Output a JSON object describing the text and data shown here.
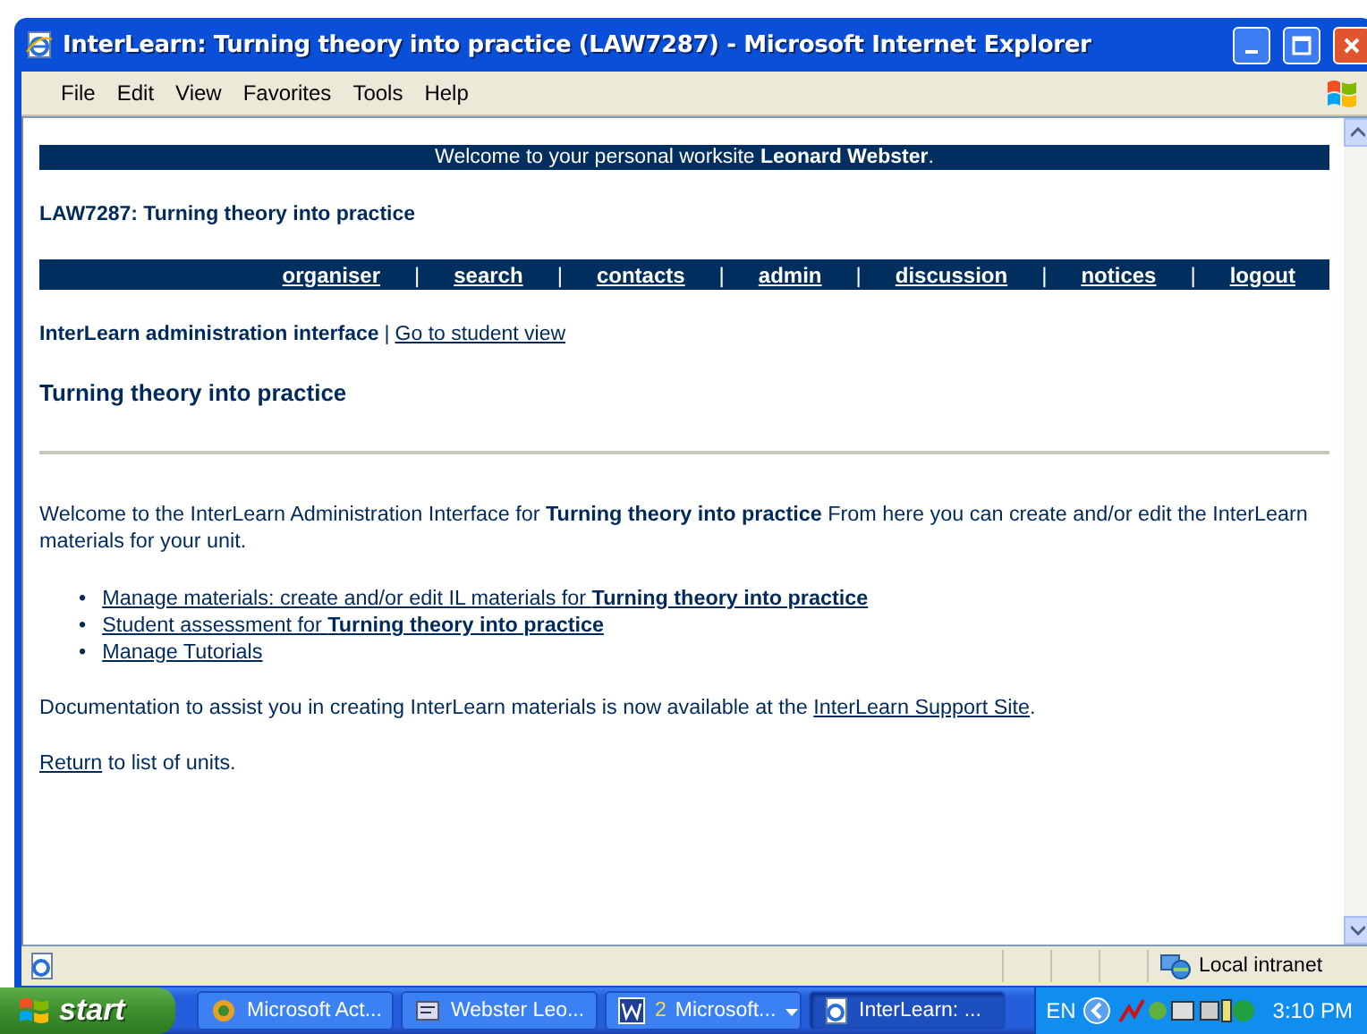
{
  "window": {
    "title": "InterLearn: Turning theory into practice (LAW7287) - Microsoft Internet Explorer"
  },
  "menu_bar": [
    "File",
    "Edit",
    "View",
    "Favorites",
    "Tools",
    "Help"
  ],
  "page": {
    "welcome_banner": "Welcome to your personal worksite **Leonard Webster**.",
    "unit_heading": "LAW7287: Turning theory into practice",
    "nav_links": [
      "organiser",
      "search",
      "contacts",
      "admin",
      "discussion",
      "notices",
      "logout"
    ],
    "nav_separator": "|",
    "admin_label": "InterLearn administration interface",
    "admin_separator": "|",
    "admin_link": "Go to student view",
    "section_title": "Turning theory into practice",
    "intro": "Welcome to the InterLearn Administration Interface for **Turning theory into practice** From here you can create and/or edit the InterLearn materials for your unit.",
    "links": [
      {
        "bullet": "•",
        "text": "Manage materials: create and/or edit IL materials for **Turning theory into practice**"
      },
      {
        "bullet": "•",
        "text": "Student assessment for **Turning theory into practice**"
      },
      {
        "bullet": "•",
        "text": "Manage Tutorials"
      }
    ],
    "documentation": {
      "text": "Documentation to assist you in creating InterLearn materials is now available at the ",
      "link": "InterLearn Support Site",
      "after": "."
    },
    "return_line": {
      "link": "Return",
      "after": " to list of units."
    }
  },
  "status_bar": {
    "zone": "Local intranet"
  },
  "taskbar": {
    "start": "start",
    "tasks": [
      {
        "label": "Microsoft Act...",
        "kind": "app",
        "selected": false
      },
      {
        "label": "Webster Leo...",
        "kind": "folder",
        "selected": false
      },
      {
        "count": "2",
        "label": "Microsoft...",
        "kind": "word",
        "selected": false
      },
      {
        "label": "InterLearn: ...",
        "kind": "browser",
        "selected": true
      }
    ],
    "language": "EN",
    "clock": "3:10 PM"
  }
}
